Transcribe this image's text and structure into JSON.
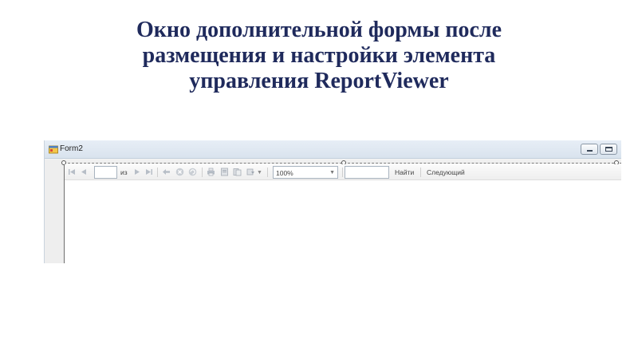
{
  "slide": {
    "title_lines": [
      "Окно дополнительной формы после",
      "размещения и настройки элемента",
      "управления ReportViewer"
    ]
  },
  "window": {
    "title": "Form2",
    "buttons": [
      "minimize-icon",
      "maximize-icon"
    ]
  },
  "toolbar": {
    "of_label": "из",
    "zoom_value": "100%",
    "find_label": "Найти",
    "next_label": "Следующий",
    "icons": [
      "first-page-icon",
      "previous-page-icon",
      "next-page-icon",
      "last-page-icon",
      "back-icon",
      "stop-icon",
      "refresh-icon",
      "print-icon",
      "print-layout-icon",
      "page-setup-icon",
      "export-icon"
    ]
  },
  "colors": {
    "title_text": "#1f2a5c",
    "titlebar": "#dde6f0",
    "viewer_bg": "#ffffff"
  }
}
